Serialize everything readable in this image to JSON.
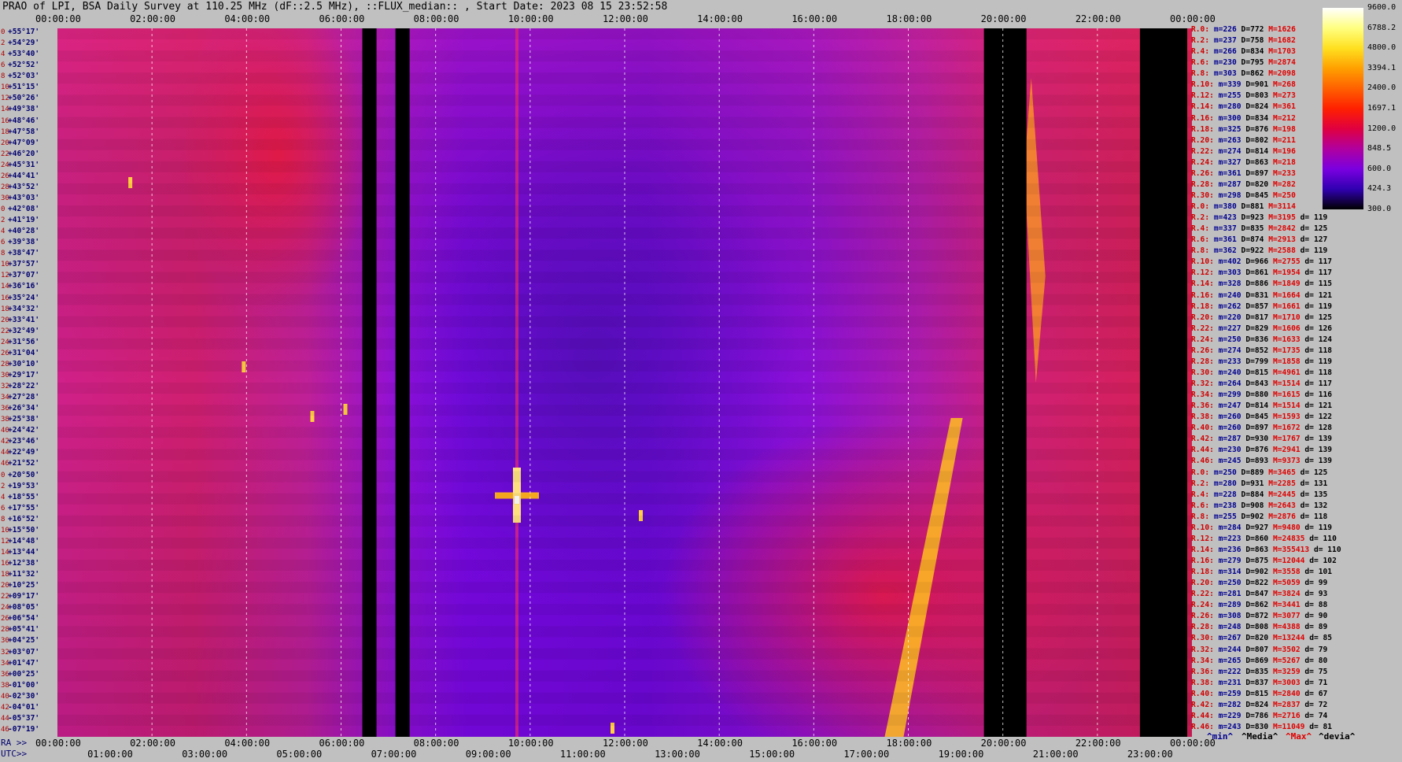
{
  "title": "PRAO of LPI, BSA Daily Survey at 110.25 MHz (dF::2.5 MHz), ::FLUX_median:: , Start Date: 2023 08 15 23:52:58",
  "chart_data": {
    "type": "heatmap",
    "x_unit": "hours",
    "x_range": [
      0,
      24
    ],
    "utc_top_ticks": [
      "00:00:00",
      "02:00:00",
      "04:00:00",
      "06:00:00",
      "08:00:00",
      "10:00:00",
      "12:00:00",
      "14:00:00",
      "16:00:00",
      "18:00:00",
      "20:00:00",
      "22:00:00",
      "00:00:00"
    ],
    "ra_bottom_ticks": [
      "00:00:00",
      "02:00:00",
      "04:00:00",
      "06:00:00",
      "08:00:00",
      "10:00:00",
      "12:00:00",
      "14:00:00",
      "16:00:00",
      "18:00:00",
      "20:00:00",
      "22:00:00",
      "00:00:00"
    ],
    "utc_bottom_ticks": [
      "01:00:00",
      "03:00:00",
      "05:00:00",
      "07:00:00",
      "09:00:00",
      "11:00:00",
      "13:00:00",
      "15:00:00",
      "17:00:00",
      "19:00:00",
      "21:00:00",
      "23:00:00"
    ],
    "ra_prefix": "RA >>",
    "utc_prefix": "UTC>>",
    "declinations": [
      "+55°17'",
      "+54°29'",
      "+53°40'",
      "+52°52'",
      "+52°03'",
      "+51°15'",
      "+50°26'",
      "+49°38'",
      "+48°46'",
      "+47°58'",
      "+47°09'",
      "+46°20'",
      "+45°31'",
      "+44°41'",
      "+43°52'",
      "+43°03'",
      "+42°08'",
      "+41°19'",
      "+40°28'",
      "+39°38'",
      "+38°47'",
      "+37°57'",
      "+37°07'",
      "+36°16'",
      "+35°24'",
      "+34°32'",
      "+33°41'",
      "+32°49'",
      "+31°56'",
      "+31°04'",
      "+30°10'",
      "+29°17'",
      "+28°22'",
      "+27°28'",
      "+26°34'",
      "+25°38'",
      "+24°42'",
      "+23°46'",
      "+22°49'",
      "+21°52'",
      "+20°50'",
      "+19°53'",
      "+18°55'",
      "+17°55'",
      "+16°52'",
      "+15°50'",
      "+14°48'",
      "+13°44'",
      "+12°38'",
      "+11°32'",
      "+10°25'",
      "+09°17'",
      "+08°05'",
      "+06°54'",
      "+05°41'",
      "+04°25'",
      "+03°07'",
      "+01°47'",
      "+00°25'",
      "-01°00'",
      "-02°30'",
      "-04°01'",
      "-05°37'",
      "-07°19'"
    ],
    "row_indices": [
      "0",
      "2",
      "4",
      "6",
      "8",
      "10",
      "12",
      "14",
      "16",
      "18",
      "20",
      "22",
      "24",
      "26",
      "28",
      "30",
      "0",
      "2",
      "4",
      "6",
      "8",
      "10",
      "12",
      "14",
      "16",
      "18",
      "20",
      "22",
      "24",
      "26",
      "28",
      "30",
      "32",
      "34",
      "36",
      "38",
      "40",
      "42",
      "44",
      "46",
      "0",
      "2",
      "4",
      "6",
      "8",
      "10",
      "12",
      "14",
      "16",
      "18",
      "20",
      "22",
      "24",
      "26",
      "28",
      "30",
      "32",
      "34",
      "36",
      "38",
      "40",
      "42",
      "44",
      "46"
    ],
    "gaps_hours": [
      [
        6.45,
        6.75
      ],
      [
        7.15,
        7.45
      ],
      [
        19.6,
        20.5
      ],
      [
        22.9,
        23.9
      ]
    ],
    "colorbar": {
      "ticks": [
        "9600.0",
        "6788.2",
        "4800.0",
        "3394.1",
        "2400.0",
        "1697.1",
        "1200.0",
        "848.5",
        "600.0",
        "424.3",
        "300.0"
      ],
      "colors": [
        "#ffffff",
        "#ffff80",
        "#ffe020",
        "#ffa000",
        "#ff6000",
        "#ff2000",
        "#e00040",
        "#b000a0",
        "#7a00e0",
        "#3000b0",
        "#000000"
      ]
    },
    "stats": [
      {
        "r": "R.0:",
        "m": "m=226",
        "d": "D=772",
        "x": "M=1626",
        "v": ""
      },
      {
        "r": "R.2:",
        "m": "m=237",
        "d": "D=758",
        "x": "M=1682",
        "v": ""
      },
      {
        "r": "R.4:",
        "m": "m=266",
        "d": "D=834",
        "x": "M=1703",
        "v": ""
      },
      {
        "r": "R.6:",
        "m": "m=230",
        "d": "D=795",
        "x": "M=2874",
        "v": ""
      },
      {
        "r": "R.8:",
        "m": "m=303",
        "d": "D=862",
        "x": "M=2098",
        "v": ""
      },
      {
        "r": "R.10:",
        "m": "m=339",
        "d": "D=901",
        "x": "M=268",
        "v": ""
      },
      {
        "r": "R.12:",
        "m": "m=255",
        "d": "D=803",
        "x": "M=273",
        "v": ""
      },
      {
        "r": "R.14:",
        "m": "m=280",
        "d": "D=824",
        "x": "M=361",
        "v": ""
      },
      {
        "r": "R.16:",
        "m": "m=300",
        "d": "D=834",
        "x": "M=212",
        "v": ""
      },
      {
        "r": "R.18:",
        "m": "m=325",
        "d": "D=876",
        "x": "M=198",
        "v": ""
      },
      {
        "r": "R.20:",
        "m": "m=263",
        "d": "D=802",
        "x": "M=211",
        "v": ""
      },
      {
        "r": "R.22:",
        "m": "m=274",
        "d": "D=814",
        "x": "M=196",
        "v": ""
      },
      {
        "r": "R.24:",
        "m": "m=327",
        "d": "D=863",
        "x": "M=218",
        "v": ""
      },
      {
        "r": "R.26:",
        "m": "m=361",
        "d": "D=897",
        "x": "M=233",
        "v": ""
      },
      {
        "r": "R.28:",
        "m": "m=287",
        "d": "D=820",
        "x": "M=282",
        "v": ""
      },
      {
        "r": "R.30:",
        "m": "m=298",
        "d": "D=845",
        "x": "M=250",
        "v": ""
      },
      {
        "r": "R.0:",
        "m": "m=380",
        "d": "D=881",
        "x": "M=3114",
        "v": ""
      },
      {
        "r": "R.2:",
        "m": "m=423",
        "d": "D=923",
        "x": "M=3195",
        "v": "d= 119"
      },
      {
        "r": "R.4:",
        "m": "m=337",
        "d": "D=835",
        "x": "M=2842",
        "v": "d= 125"
      },
      {
        "r": "R.6:",
        "m": "m=361",
        "d": "D=874",
        "x": "M=2913",
        "v": "d= 127"
      },
      {
        "r": "R.8:",
        "m": "m=362",
        "d": "D=922",
        "x": "M=2588",
        "v": "d= 119"
      },
      {
        "r": "R.10:",
        "m": "m=402",
        "d": "D=966",
        "x": "M=2755",
        "v": "d= 117"
      },
      {
        "r": "R.12:",
        "m": "m=303",
        "d": "D=861",
        "x": "M=1954",
        "v": "d= 117"
      },
      {
        "r": "R.14:",
        "m": "m=328",
        "d": "D=886",
        "x": "M=1849",
        "v": "d= 115"
      },
      {
        "r": "R.16:",
        "m": "m=240",
        "d": "D=831",
        "x": "M=1664",
        "v": "d= 121"
      },
      {
        "r": "R.18:",
        "m": "m=262",
        "d": "D=857",
        "x": "M=1661",
        "v": "d= 119"
      },
      {
        "r": "R.20:",
        "m": "m=220",
        "d": "D=817",
        "x": "M=1710",
        "v": "d= 125"
      },
      {
        "r": "R.22:",
        "m": "m=227",
        "d": "D=829",
        "x": "M=1606",
        "v": "d= 126"
      },
      {
        "r": "R.24:",
        "m": "m=250",
        "d": "D=836",
        "x": "M=1633",
        "v": "d= 124"
      },
      {
        "r": "R.26:",
        "m": "m=274",
        "d": "D=852",
        "x": "M=1735",
        "v": "d= 118"
      },
      {
        "r": "R.28:",
        "m": "m=233",
        "d": "D=799",
        "x": "M=1858",
        "v": "d= 119"
      },
      {
        "r": "R.30:",
        "m": "m=240",
        "d": "D=815",
        "x": "M=4961",
        "v": "d= 118"
      },
      {
        "r": "R.32:",
        "m": "m=264",
        "d": "D=843",
        "x": "M=1514",
        "v": "d= 117"
      },
      {
        "r": "R.34:",
        "m": "m=299",
        "d": "D=880",
        "x": "M=1615",
        "v": "d= 116"
      },
      {
        "r": "R.36:",
        "m": "m=247",
        "d": "D=814",
        "x": "M=1514",
        "v": "d= 121"
      },
      {
        "r": "R.38:",
        "m": "m=260",
        "d": "D=845",
        "x": "M=1593",
        "v": "d= 122"
      },
      {
        "r": "R.40:",
        "m": "m=260",
        "d": "D=897",
        "x": "M=1672",
        "v": "d= 128"
      },
      {
        "r": "R.42:",
        "m": "m=287",
        "d": "D=930",
        "x": "M=1767",
        "v": "d= 139"
      },
      {
        "r": "R.44:",
        "m": "m=230",
        "d": "D=876",
        "x": "M=2941",
        "v": "d= 139"
      },
      {
        "r": "R.46:",
        "m": "m=245",
        "d": "D=893",
        "x": "M=9373",
        "v": "d= 139"
      },
      {
        "r": "R.0:",
        "m": "m=250",
        "d": "D=889",
        "x": "M=3465",
        "v": "d= 125"
      },
      {
        "r": "R.2:",
        "m": "m=280",
        "d": "D=931",
        "x": "M=2285",
        "v": "d= 131"
      },
      {
        "r": "R.4:",
        "m": "m=228",
        "d": "D=884",
        "x": "M=2445",
        "v": "d= 135"
      },
      {
        "r": "R.6:",
        "m": "m=238",
        "d": "D=908",
        "x": "M=2643",
        "v": "d= 132"
      },
      {
        "r": "R.8:",
        "m": "m=255",
        "d": "D=902",
        "x": "M=2876",
        "v": "d= 118"
      },
      {
        "r": "R.10:",
        "m": "m=284",
        "d": "D=927",
        "x": "M=9480",
        "v": "d= 119"
      },
      {
        "r": "R.12:",
        "m": "m=223",
        "d": "D=860",
        "x": "M=24835",
        "v": "d= 110"
      },
      {
        "r": "R.14:",
        "m": "m=236",
        "d": "D=863",
        "x": "M=355413",
        "v": "d= 110"
      },
      {
        "r": "R.16:",
        "m": "m=279",
        "d": "D=875",
        "x": "M=12044",
        "v": "d= 102"
      },
      {
        "r": "R.18:",
        "m": "m=314",
        "d": "D=902",
        "x": "M=3558",
        "v": "d= 101"
      },
      {
        "r": "R.20:",
        "m": "m=250",
        "d": "D=822",
        "x": "M=5059",
        "v": "d= 99"
      },
      {
        "r": "R.22:",
        "m": "m=281",
        "d": "D=847",
        "x": "M=3824",
        "v": "d= 93"
      },
      {
        "r": "R.24:",
        "m": "m=289",
        "d": "D=862",
        "x": "M=3441",
        "v": "d= 88"
      },
      {
        "r": "R.26:",
        "m": "m=308",
        "d": "D=872",
        "x": "M=3077",
        "v": "d= 90"
      },
      {
        "r": "R.28:",
        "m": "m=248",
        "d": "D=808",
        "x": "M=4388",
        "v": "d= 89"
      },
      {
        "r": "R.30:",
        "m": "m=267",
        "d": "D=820",
        "x": "M=13244",
        "v": "d= 85"
      },
      {
        "r": "R.32:",
        "m": "m=244",
        "d": "D=807",
        "x": "M=3502",
        "v": "d= 79"
      },
      {
        "r": "R.34:",
        "m": "m=265",
        "d": "D=869",
        "x": "M=5267",
        "v": "d= 80"
      },
      {
        "r": "R.36:",
        "m": "m=222",
        "d": "D=835",
        "x": "M=3259",
        "v": "d= 75"
      },
      {
        "r": "R.38:",
        "m": "m=231",
        "d": "D=837",
        "x": "M=3003",
        "v": "d= 71"
      },
      {
        "r": "R.40:",
        "m": "m=259",
        "d": "D=815",
        "x": "M=2840",
        "v": "d= 67"
      },
      {
        "r": "R.42:",
        "m": "m=282",
        "d": "D=824",
        "x": "M=2837",
        "v": "d= 72"
      },
      {
        "r": "R.44:",
        "m": "m=229",
        "d": "D=786",
        "x": "M=2716",
        "v": "d= 74"
      },
      {
        "r": "R.46:",
        "m": "m=243",
        "d": "D=830",
        "x": "M=11049",
        "v": "d= 81"
      }
    ],
    "footer_legend": {
      "min": "^min^",
      "median": "^Media^",
      "max": "^Max^",
      "dev": "^devia^"
    }
  }
}
